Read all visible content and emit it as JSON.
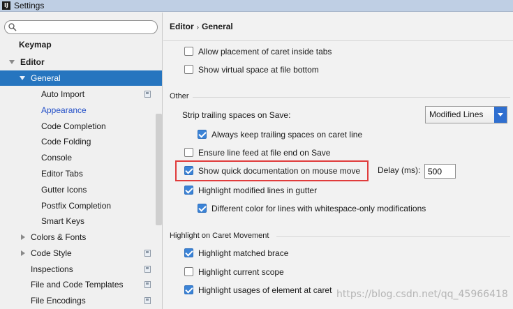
{
  "window": {
    "title": "Settings",
    "app_icon": "IJ"
  },
  "sidebar": {
    "search": {
      "value": "",
      "placeholder": ""
    },
    "items": [
      {
        "label": "Keymap"
      },
      {
        "label": "Editor"
      },
      {
        "label": "General"
      },
      {
        "label": "Auto Import"
      },
      {
        "label": "Appearance"
      },
      {
        "label": "Code Completion"
      },
      {
        "label": "Code Folding"
      },
      {
        "label": "Console"
      },
      {
        "label": "Editor Tabs"
      },
      {
        "label": "Gutter Icons"
      },
      {
        "label": "Postfix Completion"
      },
      {
        "label": "Smart Keys"
      },
      {
        "label": "Colors & Fonts"
      },
      {
        "label": "Code Style"
      },
      {
        "label": "Inspections"
      },
      {
        "label": "File and Code Templates"
      },
      {
        "label": "File Encodings"
      }
    ]
  },
  "breadcrumb": {
    "parent": "Editor",
    "separator": "›",
    "current": "General"
  },
  "options": {
    "caret_tabs": {
      "label": "Allow placement of caret inside tabs",
      "checked": false
    },
    "virtual_space": {
      "label": "Show virtual space at file bottom",
      "checked": false
    }
  },
  "other": {
    "title": "Other",
    "strip_label": "Strip trailing spaces on Save:",
    "strip_value": "Modified Lines",
    "keep_trailing": {
      "label": "Always keep trailing spaces on caret line",
      "checked": true
    },
    "line_feed": {
      "label": "Ensure line feed at file end on Save",
      "checked": false
    },
    "quick_doc": {
      "label": "Show quick documentation on mouse move",
      "checked": true
    },
    "delay_label": "Delay (ms):",
    "delay_value": "500",
    "highlight_modified": {
      "label": "Highlight modified lines in gutter",
      "checked": true
    },
    "different_color": {
      "label": "Different color for lines with whitespace-only modifications",
      "checked": true
    }
  },
  "caret_movement": {
    "title": "Highlight on Caret Movement",
    "matched_brace": {
      "label": "Highlight matched brace",
      "checked": true
    },
    "current_scope": {
      "label": "Highlight current scope",
      "checked": false
    },
    "usages": {
      "label": "Highlight usages of element at caret",
      "checked": true
    }
  },
  "watermark": "https://blog.csdn.net/qq_45966418",
  "colors": {
    "selection": "#2675bf",
    "checkbox": "#3b83d6",
    "highlight_border": "#e03c3c",
    "link": "#2450c8"
  }
}
